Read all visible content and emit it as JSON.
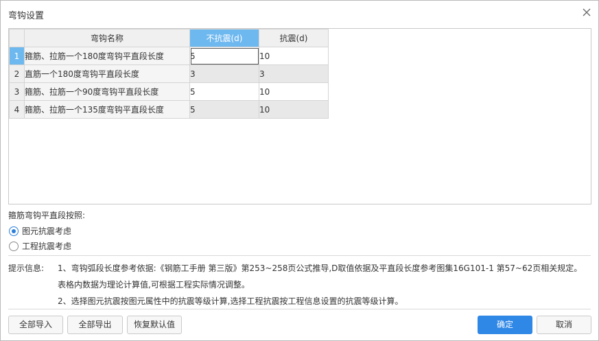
{
  "dialog": {
    "title": "弯钩设置"
  },
  "grid": {
    "headers": [
      "弯钩名称",
      "不抗震(d)",
      "抗震(d)"
    ],
    "rows": [
      {
        "num": "1",
        "name": "箍筋、拉筋一个180度弯钩平直段长度",
        "nonseismic": "5",
        "seismic": "10"
      },
      {
        "num": "2",
        "name": "直筋一个180度弯钩平直段长度",
        "nonseismic": "3",
        "seismic": "3"
      },
      {
        "num": "3",
        "name": "箍筋、拉筋一个90度弯钩平直段长度",
        "nonseismic": "5",
        "seismic": "10"
      },
      {
        "num": "4",
        "name": "箍筋、拉筋一个135度弯钩平直段长度",
        "nonseismic": "5",
        "seismic": "10"
      }
    ]
  },
  "stirrup_option": {
    "label": "箍筋弯钩平直段按照:",
    "options": [
      {
        "label": "图元抗震考虑",
        "selected": true
      },
      {
        "label": "工程抗震考虑",
        "selected": false
      }
    ]
  },
  "hint": {
    "label": "提示信息:",
    "lines": [
      "1、弯钩弧段长度参考依据:《钢筋工手册 第三版》第253~258页公式推导,D取值依据及平直段长度参考图集16G101-1 第57~62页相关规定。",
      "表格内数据为理论计算值,可根据工程实际情况调整。",
      "2、选择图元抗震按图元属性中的抗震等级计算,选择工程抗震按工程信息设置的抗震等级计算。"
    ]
  },
  "buttons": {
    "import_all": "全部导入",
    "export_all": "全部导出",
    "restore_default": "恢复默认值",
    "ok": "确定",
    "cancel": "取消"
  },
  "colors": {
    "accent": "#2f87e6",
    "header_selected": "#6eb8f0"
  }
}
